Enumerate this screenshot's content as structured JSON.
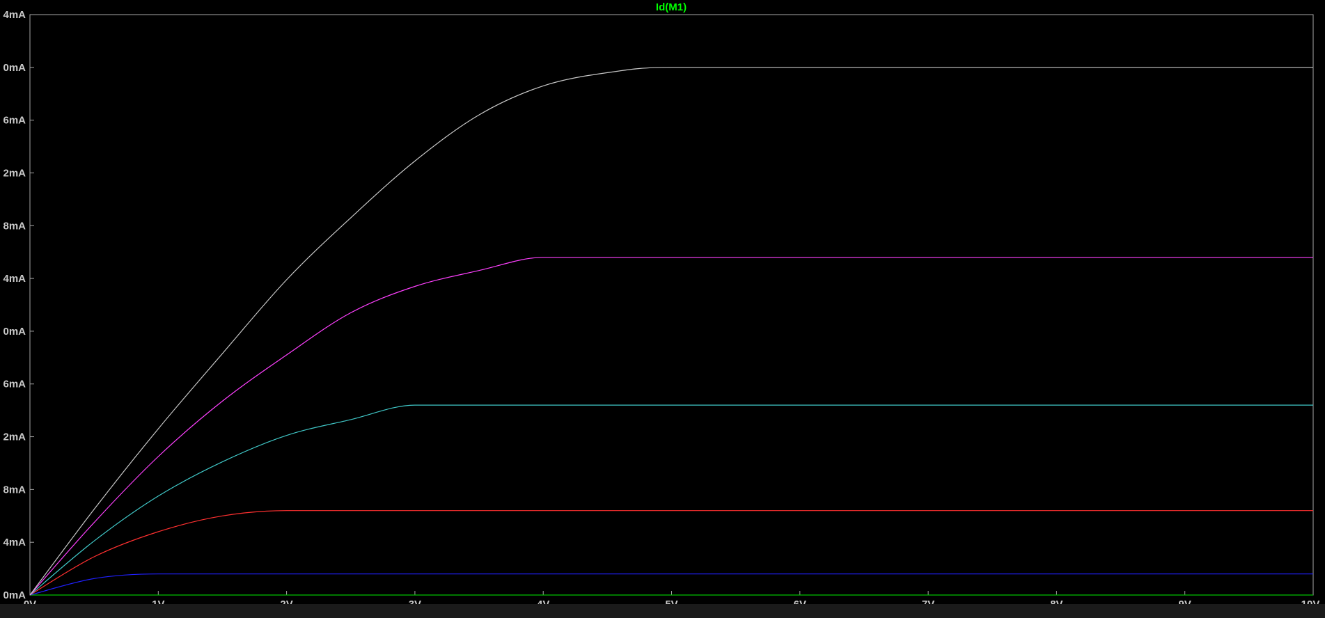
{
  "title": "Id(M1)",
  "colors": {
    "background": "#000000",
    "axis": "#a8a8a8",
    "tick_text": "#c8c8c8",
    "title": "#00ff00"
  },
  "chart_data": {
    "type": "line",
    "title": "Id(M1)",
    "xlabel": "",
    "ylabel": "",
    "xlim": [
      0,
      10
    ],
    "ylim": [
      0,
      44
    ],
    "grid": false,
    "x_ticks": [
      "0V",
      "1V",
      "2V",
      "3V",
      "4V",
      "5V",
      "6V",
      "7V",
      "8V",
      "9V",
      "10V"
    ],
    "y_ticks": [
      "0mA",
      "4mA",
      "8mA",
      "2mA",
      "6mA",
      "0mA",
      "4mA",
      "8mA",
      "2mA",
      "6mA",
      "0mA",
      "4mA"
    ],
    "x": [
      0,
      0.5,
      1,
      1.5,
      2,
      2.5,
      3,
      3.5,
      4,
      4.5,
      5,
      6,
      7,
      8,
      9,
      10
    ],
    "series": [
      {
        "color": "#00c000",
        "values": [
          0,
          0,
          0,
          0,
          0,
          0,
          0,
          0,
          0,
          0,
          0,
          0,
          0,
          0,
          0,
          0
        ]
      },
      {
        "color": "#2020ff",
        "values": [
          0,
          1.25,
          1.6,
          1.6,
          1.6,
          1.6,
          1.6,
          1.6,
          1.6,
          1.6,
          1.6,
          1.6,
          1.6,
          1.6,
          1.6,
          1.6
        ]
      },
      {
        "color": "#ff3030",
        "values": [
          0,
          2.9,
          4.8,
          6.0,
          6.4,
          6.4,
          6.4,
          6.4,
          6.4,
          6.4,
          6.4,
          6.4,
          6.4,
          6.4,
          6.4,
          6.4
        ]
      },
      {
        "color": "#40c8c8",
        "values": [
          0,
          4.1,
          7.5,
          10.1,
          12.1,
          13.3,
          14.4,
          14.4,
          14.4,
          14.4,
          14.4,
          14.4,
          14.4,
          14.4,
          14.4,
          14.4
        ]
      },
      {
        "color": "#ff40ff",
        "values": [
          0,
          5.5,
          10.5,
          14.7,
          18.2,
          21.4,
          23.4,
          24.6,
          25.6,
          25.6,
          25.6,
          25.6,
          25.6,
          25.6,
          25.6,
          25.6
        ]
      },
      {
        "color": "#c8c8c8",
        "values": [
          0,
          6.5,
          12.6,
          18.3,
          23.9,
          28.6,
          32.9,
          36.4,
          38.6,
          39.6,
          40.0,
          40.0,
          40.0,
          40.0,
          40.0,
          40.0
        ]
      }
    ]
  }
}
